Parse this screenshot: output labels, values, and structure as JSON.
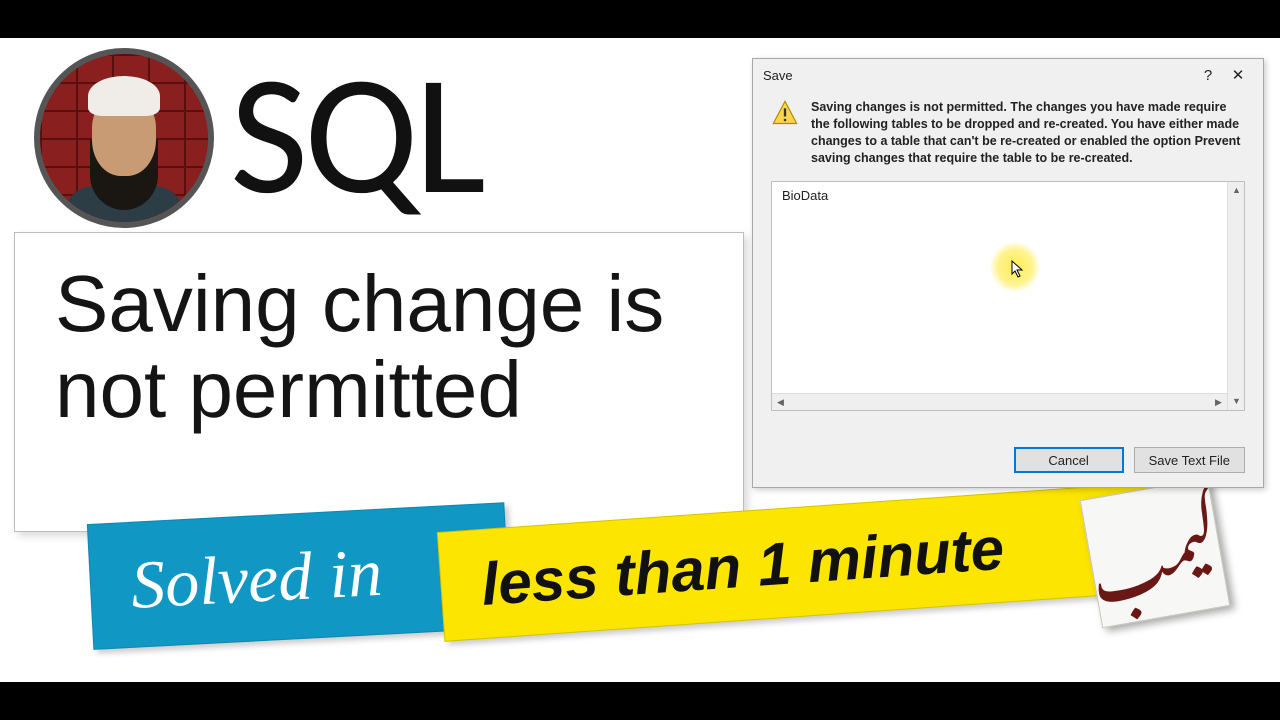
{
  "title_sql": "SQL",
  "main_phrase": "Saving change is not permitted",
  "banner": {
    "solved": "Solved in",
    "minute": "less than 1 minute"
  },
  "dialog": {
    "title": "Save",
    "help": "?",
    "close": "✕",
    "message": "Saving changes is not permitted. The changes you have made require the following tables to be dropped and re-created. You have either made changes to a table that can't be re-created or enabled the option Prevent saving changes that require the table to be re-created.",
    "list_item": "BioData",
    "cancel": "Cancel",
    "save_text": "Save Text File"
  },
  "scroll": {
    "up": "▲",
    "down": "▼",
    "left": "◀",
    "right": "▶"
  },
  "logo_script": "كيمب"
}
